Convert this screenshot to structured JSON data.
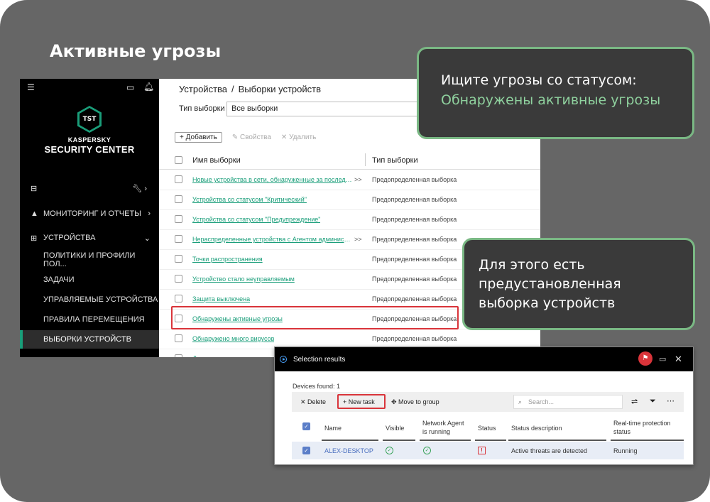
{
  "slide": {
    "title": "Активные угрозы"
  },
  "sidebar": {
    "logo_text": "TST",
    "brand_line1": "KASPERSKY",
    "brand_line2": "SECURITY CENTER",
    "items": [
      {
        "label": "МОНИТОРИНГ И ОТЧЕТЫ"
      },
      {
        "label": "УСТРОЙСТВА"
      },
      {
        "label": "ПОЛИТИКИ И ПРОФИЛИ ПОЛ..."
      },
      {
        "label": "ЗАДАЧИ"
      },
      {
        "label": "УПРАВЛЯЕМЫЕ УСТРОЙСТВА"
      },
      {
        "label": "ПРАВИЛА ПЕРЕМЕЩЕНИЯ"
      },
      {
        "label": "ВЫБОРКИ УСТРОЙСТВ"
      }
    ]
  },
  "content": {
    "breadcrumb": {
      "part1": "Устройства",
      "sep": "/",
      "part2": "Выборки устройств"
    },
    "filter_label": "Тип выборки",
    "filter_value": "Все выборки",
    "toolbar": {
      "add": "Добавить",
      "properties": "Свойства",
      "delete": "Удалить"
    },
    "table": {
      "col_name": "Имя выборки",
      "col_type": "Тип выборки",
      "rows": [
        {
          "name": "Новые устройства в сети, обнаруженные за последние ...",
          "more": ">>",
          "type": "Предопределенная выборка"
        },
        {
          "name": "Устройства со статусом \"Критический\"",
          "more": "",
          "type": "Предопределенная выборка"
        },
        {
          "name": "Устройства со статусом \"Предупреждение\"",
          "more": "",
          "type": "Предопределенная выборка"
        },
        {
          "name": "Нераспределенные устройства с Агентом администри...",
          "more": ">>",
          "type": "Предопределенная выборка"
        },
        {
          "name": "Точки распространения",
          "more": "",
          "type": "Предопределенная выборка"
        },
        {
          "name": "Устройство стало неуправляемым",
          "more": "",
          "type": "Предопределенная выборка"
        },
        {
          "name": "Защита выключена",
          "more": "",
          "type": "Предопределенная выборка"
        },
        {
          "name": "Обнаружены активные угрозы",
          "more": "",
          "type": "Предопределенная выборка"
        },
        {
          "name": "Обнаружено много вирусов",
          "more": "",
          "type": "Предопределенная выборка"
        },
        {
          "name": "Давно не выполнялся поиск вирусов",
          "more": "",
          "type": "Предопределенная выборка"
        }
      ]
    }
  },
  "callout1": {
    "line1": "Ищите угрозы со статусом:",
    "line2": "Обнаружены активные угрозы"
  },
  "callout2": {
    "text": "Для этого есть предустановленная выборка устройств"
  },
  "panel": {
    "title": "Selection results",
    "flag_icon": "⚑",
    "found": "Devices found: 1",
    "toolbar": {
      "delete": "Delete",
      "new_task": "New task",
      "move": "Move to group",
      "search_placeholder": "Search..."
    },
    "headers": {
      "name": "Name",
      "visible": "Visible",
      "agent_line1": "Network Agent",
      "agent_line2": "is running",
      "status": "Status",
      "status_desc": "Status description",
      "rtp_line1": "Real-time protection",
      "rtp_line2": "status"
    },
    "row": {
      "name": "ALEX-DESKTOP",
      "status_desc": "Active threats are detected",
      "rtp": "Running"
    }
  },
  "colors": {
    "accent_green": "#1a9e7a",
    "callout_border": "#7ab884",
    "highlight_red": "#d9343a"
  }
}
